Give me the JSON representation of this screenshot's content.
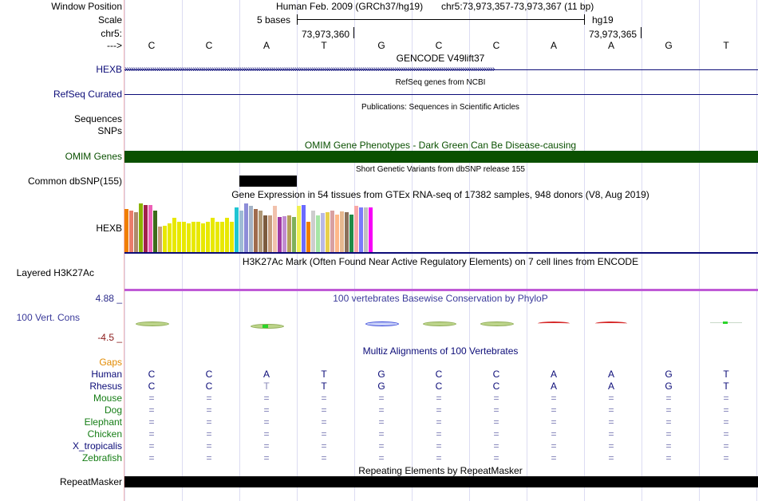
{
  "labels": {
    "window_position": "Window Position",
    "scale": "Scale",
    "chr": "chr5:",
    "arrow": "--->",
    "hexb_gene": "HEXB",
    "refseq": "RefSeq Curated",
    "sequences": "Sequences",
    "snps": "SNPs",
    "omim": "OMIM Genes",
    "common_dbsnp": "Common dbSNP(155)",
    "hexb_gtex": "HEXB",
    "h3k27ac": "Layered H3K27Ac",
    "cons_max": "4.88 _",
    "vert_cons": "100 Vert. Cons",
    "cons_min": "-4.5 _",
    "gaps": "Gaps",
    "human": "Human",
    "rhesus": "Rhesus",
    "mouse": "Mouse",
    "dog": "Dog",
    "elephant": "Elephant",
    "chicken": "Chicken",
    "x_tropicalis": "X_tropicalis",
    "zebrafish": "Zebrafish",
    "repeatmasker": "RepeatMasker"
  },
  "header": {
    "assembly": "Human Feb. 2009 (GRCh37/hg19)",
    "position": "chr5:73,973,357-73,973,367 (11 bp)",
    "scale_text": "5 bases",
    "db": "hg19",
    "coord1": "73,973,360",
    "coord2": "73,973,365"
  },
  "bases": [
    "C",
    "C",
    "A",
    "T",
    "G",
    "C",
    "C",
    "A",
    "A",
    "G",
    "T"
  ],
  "rhesus_bases": [
    "C",
    "C",
    "T",
    "T",
    "G",
    "C",
    "C",
    "A",
    "A",
    "G",
    "T"
  ],
  "track_titles": {
    "gencode": "GENCODE V49lift37",
    "refseq": "RefSeq genes from NCBI",
    "publications": "Publications: Sequences in Scientific Articles",
    "omim": "OMIM Gene Phenotypes - Dark Green Can Be Disease-causing",
    "dbsnp": "Short Genetic Variants from dbSNP release 155",
    "gtex": "Gene Expression in 54 tissues from GTEx RNA-seq of 17382 samples, 948 donors (V8, Aug 2019)",
    "h3k27ac": "H3K27Ac Mark (Often Found Near Active Regulatory Elements) on 7 cell lines from ENCODE",
    "phylop": "100 vertebrates Basewise Conservation by PhyloP",
    "multiz": "Multiz Alignments of 100 Vertebrates",
    "repeatmasker": "Repeating Elements by RepeatMasker"
  },
  "gap_glyph": "=",
  "colors": {
    "gencode_blue": "#0c0c78",
    "omim_green": "#0a5000",
    "phylop_blue": "#3a3a9a",
    "cons_max": "#2a2a8a",
    "cons_min": "#8b1a1a",
    "gaps_orange": "#e28a00",
    "species_green": "#157d15",
    "purple": "#bf5ad6"
  },
  "gtex_colors": [
    "#f07e00",
    "#ea7d6c",
    "#ae8a6c",
    "#8bb300",
    "#a1214c",
    "#ed5fb7",
    "#3c6b1c",
    "#c7a07b",
    "#e8e800",
    "#e8e800",
    "#e8e800",
    "#e8e800",
    "#e8e800",
    "#e8e800",
    "#e8e800",
    "#e8e800",
    "#e8e800",
    "#e8e800",
    "#e8e800",
    "#e8e800",
    "#e8e800",
    "#e8e800",
    "#e8e800",
    "#1fc5d3",
    "#9fbcd4",
    "#8d8dd8",
    "#a4b3c6",
    "#9f6b4d",
    "#b09876",
    "#7c5b3e",
    "#c89f80",
    "#f1c1ac",
    "#a03aa5",
    "#c18bd1",
    "#b59f5b",
    "#7fb059",
    "#f0f052",
    "#6b6bff",
    "#f07e00",
    "#cdcdcd",
    "#a6e6a6",
    "#b9b9e6",
    "#e8d04c",
    "#d9a0a0",
    "#ffb889",
    "#e6b890",
    "#8a6f5a",
    "#1f8b46",
    "#f8a7a7",
    "#7a7afb",
    "#c0c0c0",
    "#f700f7"
  ],
  "gtex_values": [
    0.85,
    0.82,
    0.78,
    0.95,
    0.92,
    0.92,
    0.82,
    0.5,
    0.52,
    0.56,
    0.67,
    0.6,
    0.6,
    0.56,
    0.6,
    0.6,
    0.56,
    0.6,
    0.67,
    0.6,
    0.6,
    0.67,
    0.6,
    0.88,
    0.82,
    0.96,
    0.9,
    0.85,
    0.82,
    0.72,
    0.72,
    0.9,
    0.68,
    0.7,
    0.72,
    0.68,
    0.9,
    0.92,
    0.6,
    0.82,
    0.72,
    0.76,
    0.78,
    0.82,
    0.74,
    0.8,
    0.78,
    0.74,
    0.9,
    0.88,
    0.88,
    0.88
  ]
}
